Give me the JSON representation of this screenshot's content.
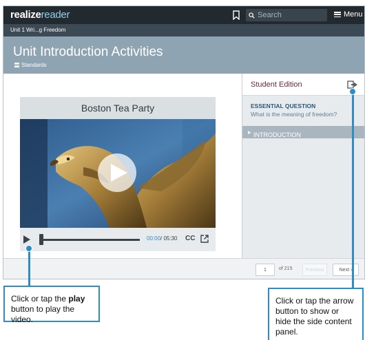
{
  "header": {
    "brand_bold": "realize",
    "brand_light": "reader",
    "search_placeholder": "Search",
    "menu_label": "Menu"
  },
  "breadcrumb": "Unit 1 Wri...g Freedom",
  "page": {
    "title": "Unit Introduction Activities",
    "standards_label": "Standards"
  },
  "video": {
    "title": "Boston Tea Party",
    "time_current": "00:00",
    "time_total": "/ 05:30",
    "cc_label": "CC",
    "progress": 0
  },
  "side_panel": {
    "title": "Student Edition",
    "essential_label": "ESSENTIAL QUESTION",
    "essential_text": "What is the meaning of freedom?",
    "section_label": "INTRODUCTION"
  },
  "pagination": {
    "current_page": "1",
    "of_label": "of 215",
    "previous_label": "Previous",
    "next_label": "Next"
  },
  "callouts": {
    "play": {
      "before": "Click or tap the ",
      "bold": "play",
      "after": " button to play the video."
    },
    "panel": "Click or tap the arrow button to show or hide the side content panel."
  },
  "colors": {
    "accent": "#2a8fc6",
    "topbar": "#222a30",
    "titlebar": "#8fa4b2",
    "side_title": "#6b2a3a"
  }
}
